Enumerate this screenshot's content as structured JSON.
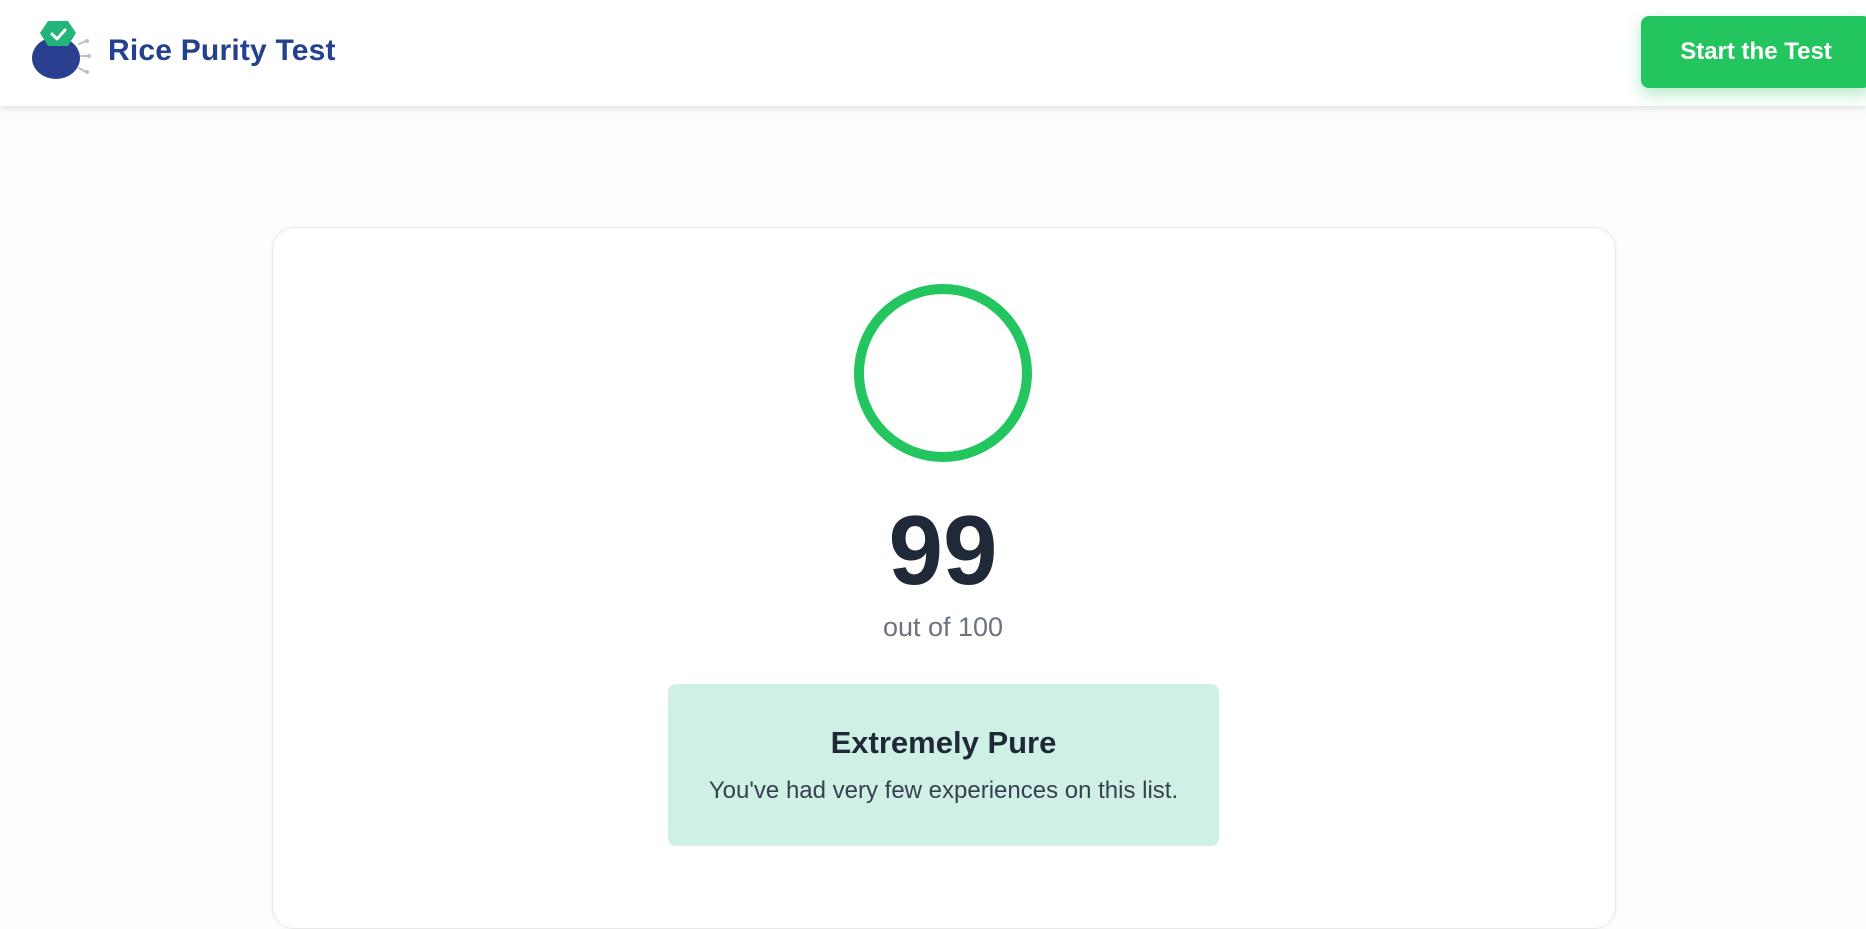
{
  "header": {
    "brand": "Rice Purity Test",
    "cta_label": "Start the Test",
    "logo_icon": "rice-bowl-check-icon"
  },
  "result": {
    "score": "99",
    "score_max_label": "out of 100",
    "score_fraction": 0.99,
    "category_title": "Extremely Pure",
    "category_description": "You've had very few experiences on this list."
  },
  "colors": {
    "brand_text": "#23418f",
    "accent_green": "#22c55e",
    "result_box_bg": "#cff0e4",
    "score_text": "#1f2937"
  }
}
